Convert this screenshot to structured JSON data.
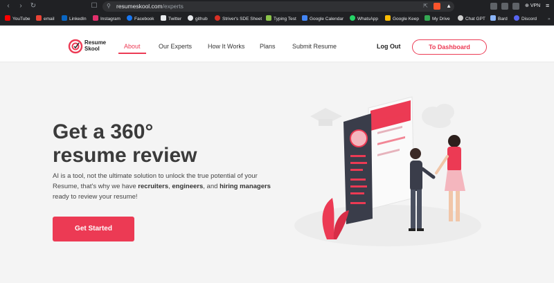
{
  "browser": {
    "url_host": "resumeskool.com",
    "url_path": "/experts",
    "vpn_label": "VPN",
    "bookmarks": [
      {
        "label": "YouTube",
        "color": "#ff0000"
      },
      {
        "label": "email",
        "color": "#ea4335"
      },
      {
        "label": "LinkedIn",
        "color": "#0a66c2"
      },
      {
        "label": "Instagram",
        "color": "#e1306c"
      },
      {
        "label": "Facebook",
        "color": "#1877f2"
      },
      {
        "label": "Twitter",
        "color": "#e8eaed"
      },
      {
        "label": "github",
        "color": "#e8eaed"
      },
      {
        "label": "Striver's SDE Sheet",
        "color": "#d93025"
      },
      {
        "label": "Typing Test",
        "color": "#8bc34a"
      },
      {
        "label": "Google Calendar",
        "color": "#4285f4"
      },
      {
        "label": "WhatsApp",
        "color": "#25d366"
      },
      {
        "label": "Google Keep",
        "color": "#fbbc04"
      },
      {
        "label": "My Drive",
        "color": "#34a853"
      },
      {
        "label": "Chat GPT",
        "color": "#cfcfcf"
      },
      {
        "label": "Bard",
        "color": "#8ab4f8"
      },
      {
        "label": "Discord",
        "color": "#5865f2"
      }
    ]
  },
  "header": {
    "logo_line1": "Resume",
    "logo_line2": "Skool",
    "nav": [
      "About",
      "Our Experts",
      "How It Works",
      "Plans",
      "Submit Resume"
    ],
    "logout": "Log Out",
    "dashboard": "To Dashboard"
  },
  "hero": {
    "title_line1": "Get a 360°",
    "title_line2": "resume review",
    "desc_part1": "AI is a tool, not the ultimate solution to unlock the true potential of your Resume, that's why we have ",
    "desc_b1": "recruiters",
    "desc_part2": ", ",
    "desc_b2": "engineers",
    "desc_part3": ", and ",
    "desc_b3": "hiring managers",
    "desc_part4": " ready to review your resume!",
    "cta": "Get Started"
  },
  "colors": {
    "brand": "#ec3a54",
    "title": "#3b3b3b",
    "browser_bg": "#202124"
  }
}
